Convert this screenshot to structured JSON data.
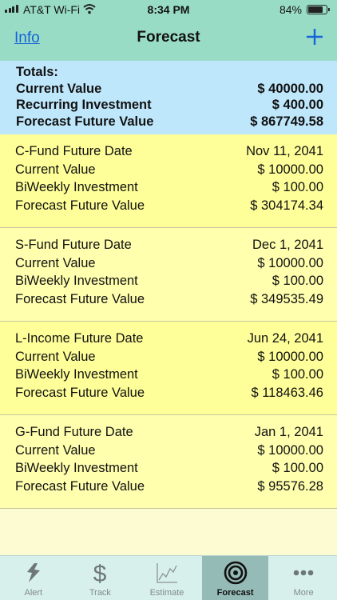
{
  "status": {
    "carrier": "AT&T Wi-Fi",
    "time": "8:34 PM",
    "battery": "84%",
    "battery_level": 0.84
  },
  "nav": {
    "left_label": "Info",
    "title": "Forecast",
    "right_icon": "plus-icon"
  },
  "totals": {
    "heading": "Totals:",
    "rows": [
      {
        "label": "Current Value",
        "value": "$ 40000.00"
      },
      {
        "label": "Recurring Investment",
        "value": "$ 400.00"
      },
      {
        "label": "Forecast Future Value",
        "value": "$ 867749.58"
      }
    ]
  },
  "funds": [
    {
      "date_label": "C-Fund Future Date",
      "date": "Nov 11, 2041",
      "current_label": "Current Value",
      "current": "$ 10000.00",
      "invest_label": "BiWeekly Investment",
      "invest": "$ 100.00",
      "forecast_label": "Forecast Future Value",
      "forecast": "$ 304174.34"
    },
    {
      "date_label": "S-Fund Future Date",
      "date": "Dec 1, 2041",
      "current_label": "Current Value",
      "current": "$ 10000.00",
      "invest_label": "BiWeekly Investment",
      "invest": "$ 100.00",
      "forecast_label": "Forecast Future Value",
      "forecast": "$ 349535.49"
    },
    {
      "date_label": "L-Income Future Date",
      "date": "Jun 24, 2041",
      "current_label": "Current Value",
      "current": "$ 10000.00",
      "invest_label": "BiWeekly Investment",
      "invest": "$ 100.00",
      "forecast_label": "Forecast Future Value",
      "forecast": "$ 118463.46"
    },
    {
      "date_label": "G-Fund Future Date",
      "date": "Jan 1, 2041",
      "current_label": "Current Value",
      "current": "$ 10000.00",
      "invest_label": "BiWeekly Investment",
      "invest": "$ 100.00",
      "forecast_label": "Forecast Future Value",
      "forecast": "$ 95576.28"
    }
  ],
  "tabs": [
    {
      "label": "Alert",
      "icon": "lightning-icon",
      "active": false
    },
    {
      "label": "Track",
      "icon": "dollar-icon",
      "active": false
    },
    {
      "label": "Estimate",
      "icon": "chart-icon",
      "active": false
    },
    {
      "label": "Forecast",
      "icon": "target-icon",
      "active": true
    },
    {
      "label": "More",
      "icon": "more-icon",
      "active": false
    }
  ],
  "colors": {
    "header": "#99dcc6",
    "totals": "#bfe7fb",
    "fund_card": "#ffff99",
    "accent": "#1463d8"
  }
}
